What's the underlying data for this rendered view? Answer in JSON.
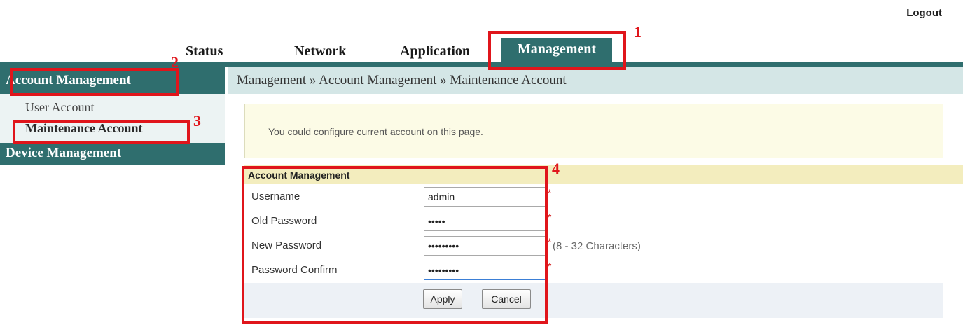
{
  "header": {
    "logout": "Logout"
  },
  "tabs": [
    {
      "label": "Status",
      "active": false
    },
    {
      "label": "Network",
      "active": false
    },
    {
      "label": "Application",
      "active": false
    },
    {
      "label": "Management",
      "active": true
    }
  ],
  "sidebar": {
    "section1": "Account Management",
    "items": [
      {
        "label": "User Account",
        "active": false
      },
      {
        "label": "Maintenance Account",
        "active": true
      }
    ],
    "section2": "Device Management"
  },
  "breadcrumb": "Management » Account Management » Maintenance Account",
  "info": "You could configure current account on this page.",
  "form": {
    "title": "Account Management",
    "fields": [
      {
        "label": "Username",
        "value": "admin",
        "required": "*",
        "hint": ""
      },
      {
        "label": "Old Password",
        "value": "•••••",
        "required": "*",
        "hint": ""
      },
      {
        "label": "New Password",
        "value": "•••••••••",
        "required": "*",
        "hint": "(8 - 32 Characters)"
      },
      {
        "label": "Password Confirm",
        "value": "•••••••••",
        "required": "*",
        "hint": ""
      }
    ],
    "apply": "Apply",
    "cancel": "Cancel"
  },
  "annotations": [
    "1",
    "2",
    "3",
    "4"
  ],
  "colors": {
    "brand": "#2f6e6e",
    "highlight": "#e0151b",
    "required": "#d21e1e"
  }
}
